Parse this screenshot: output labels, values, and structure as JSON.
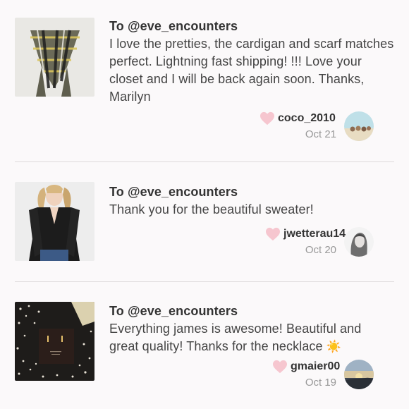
{
  "reviews": [
    {
      "to": "To @eve_encounters",
      "message": "I love the pretties, the cardigan and scarf matches perfect. Lightning fast shipping! !!! Love your closet and I will be back again soon. Thanks, Marilyn",
      "username": "coco_2010",
      "date": "Oct 21",
      "thumb_icon": "plaid-scarf-image",
      "avatar_icon": "beach-avatar"
    },
    {
      "to": "To @eve_encounters",
      "message": "Thank you for the beautiful sweater!",
      "username": "jwetterau14",
      "date": "Oct 20",
      "thumb_icon": "black-sweater-image",
      "avatar_icon": "portrait-avatar"
    },
    {
      "to": "To @eve_encounters",
      "message": "Everything james is awesome! Beautiful and great quality! Thanks for the necklace",
      "emoji": "☀️",
      "username": "gmaier00",
      "date": "Oct 19",
      "thumb_icon": "necklace-box-image",
      "avatar_icon": "sunset-avatar"
    }
  ],
  "colors": {
    "background": "#fbf9fa",
    "heart": "#f6c6cf",
    "text": "#333333",
    "date": "#999999",
    "divider": "#dedbdc"
  }
}
